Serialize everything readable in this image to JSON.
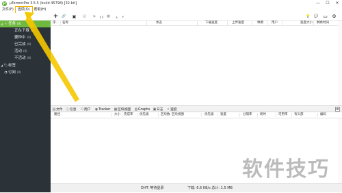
{
  "window": {
    "title": "μTorrentPro 3.5.5  (build 45798) [32-bit]",
    "minimize": "—",
    "maximize": "☐",
    "close": "✕"
  },
  "menu": {
    "items": [
      {
        "label": "文件(F)"
      },
      {
        "label": "选项(O)"
      },
      {
        "label": "帮助(H)"
      }
    ]
  },
  "toolbar": {
    "add": "+",
    "add_url": "🔗",
    "create": "▣",
    "remove": "⊘",
    "start": "▶",
    "pause": "❚❚",
    "stop": "■",
    "up": "▲",
    "down": "▼",
    "bulb": "💡",
    "chat": "💬",
    "remote": "▭",
    "prefs": "⚙"
  },
  "sidebar": {
    "items": [
      {
        "label": "任务",
        "count": "(0)",
        "icon": "lightning-icon"
      },
      {
        "label": "正在下载",
        "count": "(0)"
      },
      {
        "label": "要种中",
        "count": "(0)"
      },
      {
        "label": "已完成",
        "count": "(0)"
      },
      {
        "label": "活动",
        "count": "(0)"
      },
      {
        "label": "不活动",
        "count": "(0)"
      },
      {
        "label": "标签",
        "icon": "tag-icon"
      },
      {
        "label": "订阅",
        "count": "(0)",
        "icon": "rss-icon"
      }
    ]
  },
  "torrent_list": {
    "columns": [
      "序...",
      "名称",
      "状态",
      "下载速度",
      "上传速度",
      "种源",
      "用户",
      "速度大小",
      "剩余时间"
    ]
  },
  "detail_tabs": {
    "tabs": [
      "文件",
      "信息",
      "用户",
      "Tracker",
      "区块视图",
      "Graphs",
      "日志",
      "速度"
    ]
  },
  "detail_list": {
    "columns": [
      "路径",
      "大小",
      "完成率",
      "优先级",
      "区块数",
      "区块视图",
      "优先级",
      "速度",
      "分隔率",
      "耗时",
      "可用率",
      "有头部",
      "编码"
    ]
  },
  "status": {
    "dht": "DHT: 等待登录",
    "transfer": "下载: 6.6 KB/s 总计: 1.5 MB"
  },
  "watermark": "软件技巧",
  "colors": {
    "sidebar_bg": "#2b3338",
    "selected_green": "#70b93f",
    "highlight_outline": "#f2b400",
    "arrow_yellow": "#f5c800"
  }
}
